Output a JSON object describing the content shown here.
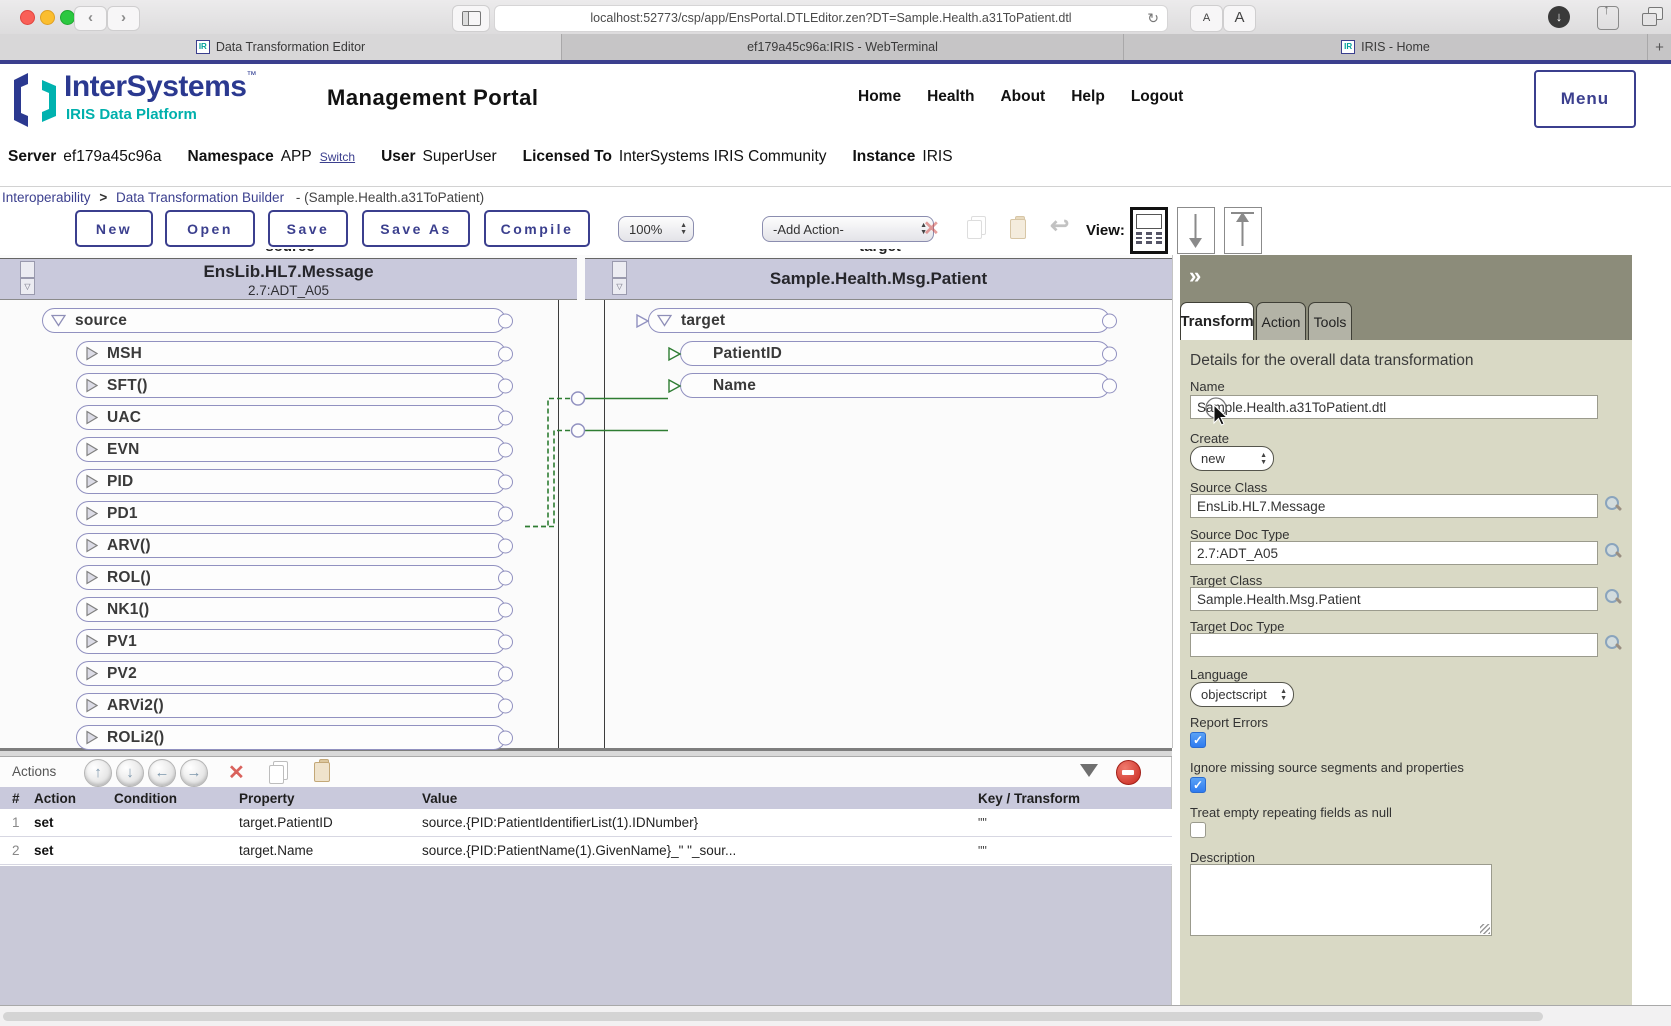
{
  "browser": {
    "url": "localhost:52773/csp/app/EnsPortal.DTLEditor.zen?DT=Sample.Health.a31ToPatient.dtl",
    "tabs": [
      {
        "label": "Data Transformation Editor",
        "favicon": "IR"
      },
      {
        "label": "ef179a45c96a:IRIS - WebTerminal",
        "favicon": ""
      },
      {
        "label": "IRIS - Home",
        "favicon": "IR"
      }
    ],
    "new_tab_label": "+",
    "back_glyph": "‹",
    "forward_glyph": "›",
    "reload_glyph": "↻",
    "reader_small": "A",
    "reader_large": "A",
    "download_glyph": "↓",
    "share_glyph": "↑"
  },
  "header": {
    "logo_text": "InterSystems",
    "logo_tm": "™",
    "logo_subtext": "IRIS Data Platform",
    "portal_title": "Management Portal",
    "nav_links": [
      "Home",
      "Health",
      "About",
      "Help",
      "Logout"
    ],
    "menu_button": "Menu"
  },
  "info_bar": {
    "items": [
      {
        "label": "Server",
        "value": "ef179a45c96a"
      },
      {
        "label": "Namespace",
        "value": "APP",
        "extra": "Switch"
      },
      {
        "label": "User",
        "value": "SuperUser"
      },
      {
        "label": "Licensed To",
        "value": "InterSystems IRIS Community"
      },
      {
        "label": "Instance",
        "value": "IRIS"
      }
    ]
  },
  "breadcrumb": {
    "root": "Interoperability",
    "sep": ">",
    "page": "Data Transformation Builder",
    "suffix": "- (Sample.Health.a31ToPatient)"
  },
  "toolbar": {
    "buttons": [
      "New",
      "Open",
      "Save",
      "Save As",
      "Compile"
    ],
    "zoom_select": "100%",
    "add_action_select": "-Add Action-",
    "view_label": "View:"
  },
  "diagram": {
    "source": {
      "clipped_label": "source",
      "class": "EnsLib.HL7.Message",
      "doc_type": "2.7:ADT_A05",
      "root": "source",
      "segments": [
        "MSH",
        "SFT()",
        "UAC",
        "EVN",
        "PID",
        "PD1",
        "ARV()",
        "ROL()",
        "NK1()",
        "PV1",
        "PV2",
        "ARVi2()",
        "ROLi2()"
      ]
    },
    "target": {
      "clipped_label": "target",
      "class": "Sample.Health.Msg.Patient",
      "root": "target",
      "properties": [
        "PatientID",
        "Name"
      ]
    },
    "connections": [
      {
        "from": "PID",
        "to": "PatientID"
      },
      {
        "from": "PID",
        "to": "Name"
      }
    ]
  },
  "actions_panel": {
    "title": "Actions",
    "table": {
      "headers": [
        "#",
        "Action",
        "Condition",
        "Property",
        "Value",
        "Key / Transform"
      ],
      "rows": [
        {
          "num": "1",
          "action": "set",
          "condition": "",
          "property": "target.PatientID",
          "value": "source.{PID:PatientIdentifierList(1).IDNumber}",
          "key": "\"\""
        },
        {
          "num": "2",
          "action": "set",
          "condition": "",
          "property": "target.Name",
          "value": "source.{PID:PatientName(1).GivenName}_\" \"_sour...",
          "key": "\"\""
        }
      ]
    }
  },
  "side_panel": {
    "collapse_glyph": "»",
    "tabs": [
      "Transform",
      "Action",
      "Tools"
    ],
    "active_tab": "Transform",
    "heading": "Details for the overall data transformation",
    "fields": {
      "name": {
        "label": "Name",
        "value": "Sample.Health.a31ToPatient.dtl"
      },
      "create": {
        "label": "Create",
        "value": "new"
      },
      "source_class": {
        "label": "Source Class",
        "value": "EnsLib.HL7.Message"
      },
      "source_doc_type": {
        "label": "Source Doc Type",
        "value": "2.7:ADT_A05"
      },
      "target_class": {
        "label": "Target Class",
        "value": "Sample.Health.Msg.Patient"
      },
      "target_doc_type": {
        "label": "Target Doc Type",
        "value": ""
      },
      "language": {
        "label": "Language",
        "value": "objectscript"
      },
      "report_errors": {
        "label": "Report Errors",
        "checked": true
      },
      "ignore_missing": {
        "label": "Ignore missing source segments and properties",
        "checked": true
      },
      "treat_empty": {
        "label": "Treat empty repeating fields as null",
        "checked": false
      },
      "description": {
        "label": "Description",
        "value": ""
      }
    }
  },
  "colors": {
    "navy": "#3b3f8e",
    "logo_navy": "#2b3990",
    "logo_teal": "#00b0ac",
    "lavender_header": "#c9c9dc",
    "tree_border": "#9191c0",
    "connection_green": "#2e7d32",
    "panel_olive_dark": "#8c8c7a",
    "panel_olive_body": "#d9d9c5",
    "checkbox_blue": "#2e7bef",
    "delete_red": "#d9625c"
  }
}
